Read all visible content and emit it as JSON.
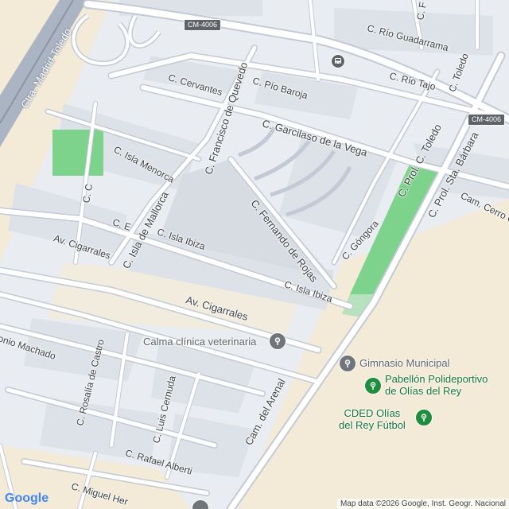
{
  "map": {
    "streets": {
      "ctra_madrid_toledo": "Ctra. Madrid Toledo",
      "c_rio_guadarrama": "C. Río Guadarrama",
      "c_rio_tajo": "C. Río Tajo",
      "c_toledo": "C. Toledo",
      "c_f_top": "C. F",
      "c_cervantes": "C. Cervantes",
      "c_pio_baroja": "C. Pío Baroja",
      "c_garcilaso": "C. Garcilaso de la Vega",
      "c_francisco_quevedo": "C. Francisco de Quevedo",
      "c_prol_toledo": "C. Prol. C. Toledo",
      "c_prol_sta_barbara": "C. Prol. Sta. Bárbara",
      "cam_cerro": "Cam. Cerro C",
      "c_isla_menorca": "C. Isla Menorca",
      "c_c": "C. C",
      "c_isla_mallorca": "C. Isla de Mallorca",
      "c_fernando_rojas": "C. Fernando de Rojas",
      "c_gongora": "C. Góngora",
      "c_e": "C. E",
      "c_isla_ibiza_1": "C. Isla Ibiza",
      "c_isla_ibiza_2": "C. Isla Ibiza",
      "av_cigarrales_1": "Av. Cigarrales",
      "av_cigarrales_2": "Av. Cigarrales",
      "antonio_machado": "onio Machado",
      "c_rosalia": "C. Rosalía de Castro",
      "c_luis_cernuda": "C. Luis Cernuda",
      "cam_arenal": "Cam. del Arenal",
      "c_rafael_alberti": "C. Rafael Alberti",
      "c_miguel_hernandez": "C. Miguel Her"
    },
    "shields": {
      "top": "CM-4006",
      "right": "CM-4006"
    },
    "pois": {
      "veterinaria": "Calma clínica veterinaria",
      "gimnasio": "Gimnasio Municipal",
      "pabellon_l1": "Pabellón Polideportivo",
      "pabellon_l2": "de Olías del Rey",
      "cded_l1": "CDED Olías",
      "cded_l2": "del Rey Fútbol"
    },
    "icons": {
      "bus": "bus-stop-icon",
      "vet": "veterinary-icon",
      "gym": "gym-icon",
      "sports": "sports-complex-icon",
      "football": "football-field-icon",
      "bottom": "place-icon"
    },
    "attribution": "Map data ©2026 Google, Inst. Geogr. Nacional",
    "logo": "Google",
    "colors": {
      "road": "#ffffff",
      "road_casing": "#c3cad5",
      "highway": "#aab4c2",
      "park": "#7ed38c",
      "land_sand": "#f3ead8",
      "block": "#e3e7ec",
      "poi_gray": "#70757a",
      "poi_green": "#1e8e3e"
    }
  }
}
